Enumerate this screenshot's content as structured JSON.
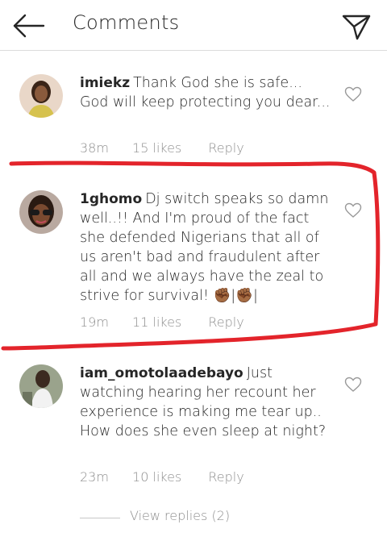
{
  "header": {
    "title": "Comments",
    "back_icon": "arrow-left-icon",
    "send_icon": "paper-plane-icon"
  },
  "comments": [
    {
      "username": "imiekz",
      "text": "Thank God she is safe... God will keep protecting you dear...",
      "time": "38m",
      "likes": "15 likes",
      "reply": "Reply"
    },
    {
      "username": "1ghomo",
      "text": "Dj switch speaks so damn well..!! And I'm proud of the fact she defended Nigerians that all of us aren't bad and fraudulent after all and we always have the zeal to strive for survival! ✊🏾|✊🏾|",
      "time": "19m",
      "likes": "11 likes",
      "reply": "Reply"
    },
    {
      "username": "iam_omotolaadebayo",
      "text": "Just watching hearing her recount her experience is making me tear up.. How does she even  sleep at night?",
      "time": "23m",
      "likes": "10 likes",
      "reply": "Reply"
    }
  ],
  "view_replies": "View replies (2)",
  "colors": {
    "highlight": "#e3242b",
    "meta": "#8e8e8e",
    "text": "#262626"
  }
}
